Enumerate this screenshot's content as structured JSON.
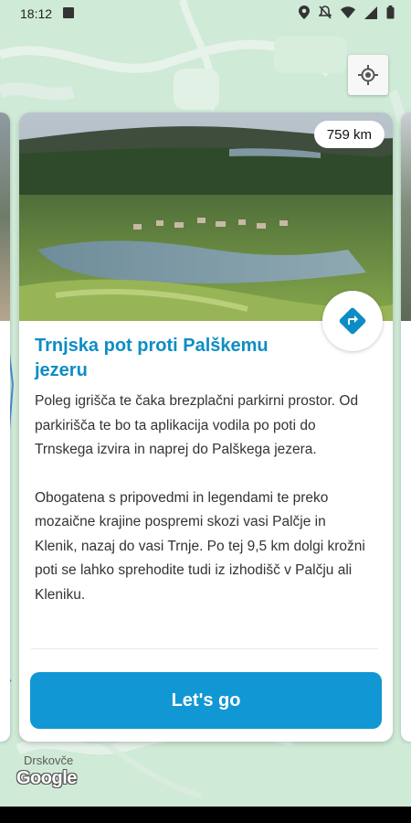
{
  "status_bar": {
    "time": "18:12",
    "icons": [
      "image-icon",
      "location-icon",
      "mute-icon",
      "wifi-icon",
      "signal-icon",
      "battery-icon"
    ]
  },
  "map": {
    "place_label": "Drskovče",
    "logo_text": "Google"
  },
  "card": {
    "distance": "759 km",
    "title": "Trnjska pot proti Palškemu jezeru",
    "paragraphs": [
      "Poleg igrišča te čaka brezplačni parkirni prostor. Od parkirišča te bo ta aplikacija vodila po poti do Trnskega izvira in naprej do Palškega jezera.",
      "Obogatena s pripovedmi in legendami te preko mozaične krajine pospremi skozi vasi Palčje in Klenik, nazaj do vasi Trnje. Po tej 9,5 km dolgi krožni poti se lahko sprehodite tudi iz izhodišč v Palčju ali Kleniku."
    ],
    "button_label": "Let's go"
  },
  "colors": {
    "accent": "#1197d3",
    "title": "#0d8dc5",
    "map_bg": "#cfead7"
  }
}
